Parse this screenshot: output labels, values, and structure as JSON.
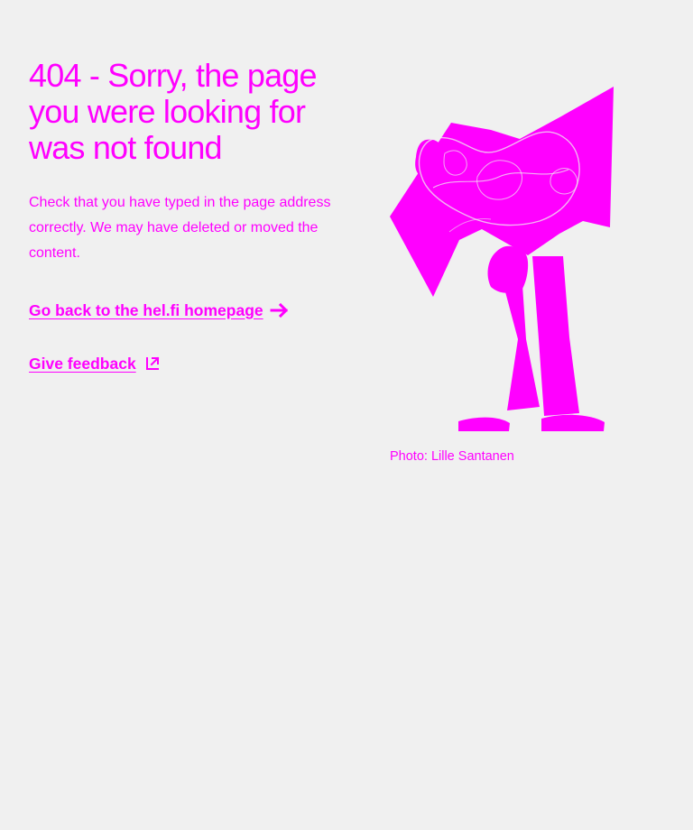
{
  "page": {
    "title": "404 - Sorry, the page you were looking for was not found",
    "lead": "Check that you have typed in the page address correctly. We may have deleted or moved the content."
  },
  "links": {
    "homepage": {
      "label": "Go back to the hel.fi homepage",
      "icon": "arrow-right-icon"
    },
    "feedback": {
      "label": "Give feedback",
      "icon": "external-link-icon"
    }
  },
  "illustration": {
    "icon": "person-reading-map-illustration",
    "caption": "Photo: Lille Santanen"
  },
  "colors": {
    "accent": "#ff00ff",
    "background": "#f0f0f0"
  }
}
